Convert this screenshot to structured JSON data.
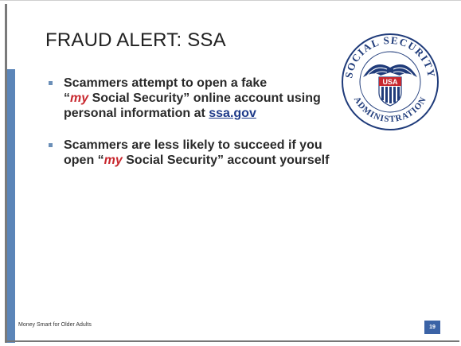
{
  "slide": {
    "title": "FRAUD ALERT: SSA",
    "bullets": [
      {
        "pre": "Scammers attempt to open a fake",
        "quote_open": "“",
        "my": "my",
        "post": " Social Security” online account using personal information at ",
        "link": "ssa.gov"
      },
      {
        "pre": "Scammers are less likely to succeed if you open ",
        "quote_open": "“",
        "my": "my",
        "post": " Social Security” account yourself"
      }
    ],
    "seal": {
      "ring_top": "SOCIAL SECURITY",
      "ring_bottom": "ADMINISTRATION",
      "shield_text": "USA"
    },
    "footer": "Money Smart for Older Adults",
    "page_number": "19"
  },
  "colors": {
    "accent": "#5b85b8",
    "highlight": "#c8282f",
    "link": "#1f3b8a",
    "seal_blue": "#1f3b7a"
  }
}
